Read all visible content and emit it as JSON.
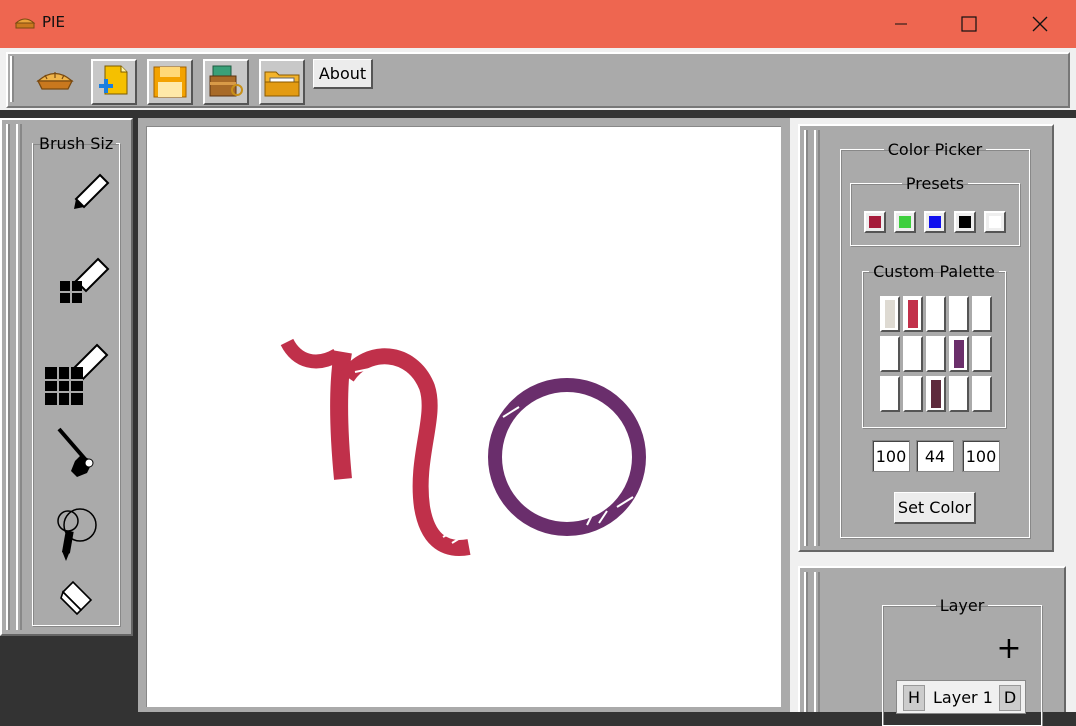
{
  "window": {
    "title": "PIE"
  },
  "toolbar": {
    "about_label": "About",
    "buttons": [
      {
        "name": "pie-logo-icon"
      },
      {
        "name": "new-file-icon"
      },
      {
        "name": "save-icon"
      },
      {
        "name": "export-icon"
      },
      {
        "name": "open-folder-icon"
      }
    ]
  },
  "brush_panel": {
    "title": "Brush Siz",
    "tools": [
      "pencil-small-icon",
      "brush-medium-icon",
      "brush-large-icon",
      "dropper-brush-icon",
      "spray-can-icon",
      "eraser-icon"
    ]
  },
  "color_picker": {
    "title": "Color Picker",
    "presets_title": "Presets",
    "presets": [
      "#a51b3a",
      "#3ecf3e",
      "#1010ee",
      "#000000",
      "#ffffff"
    ],
    "custom_palette_title": "Custom Palette",
    "palette": [
      [
        "#dedad2",
        "#c2304a",
        "#ffffff",
        "#ffffff",
        "#ffffff"
      ],
      [
        "#ffffff",
        "#ffffff",
        "#ffffff",
        "#6b2f6b",
        "#ffffff"
      ],
      [
        "#ffffff",
        "#ffffff",
        "#5e2a3c",
        "#ffffff",
        "#ffffff"
      ]
    ],
    "values": [
      "100",
      "44",
      "100"
    ],
    "set_color_label": "Set Color"
  },
  "layers": {
    "title": "Layer",
    "add_label": "+",
    "items": [
      {
        "hide": "H",
        "name": "Layer 1",
        "delete": "D"
      }
    ]
  },
  "canvas": {
    "stroke_colors": {
      "n": "#c0304a",
      "o": "#6a2e6c"
    }
  }
}
